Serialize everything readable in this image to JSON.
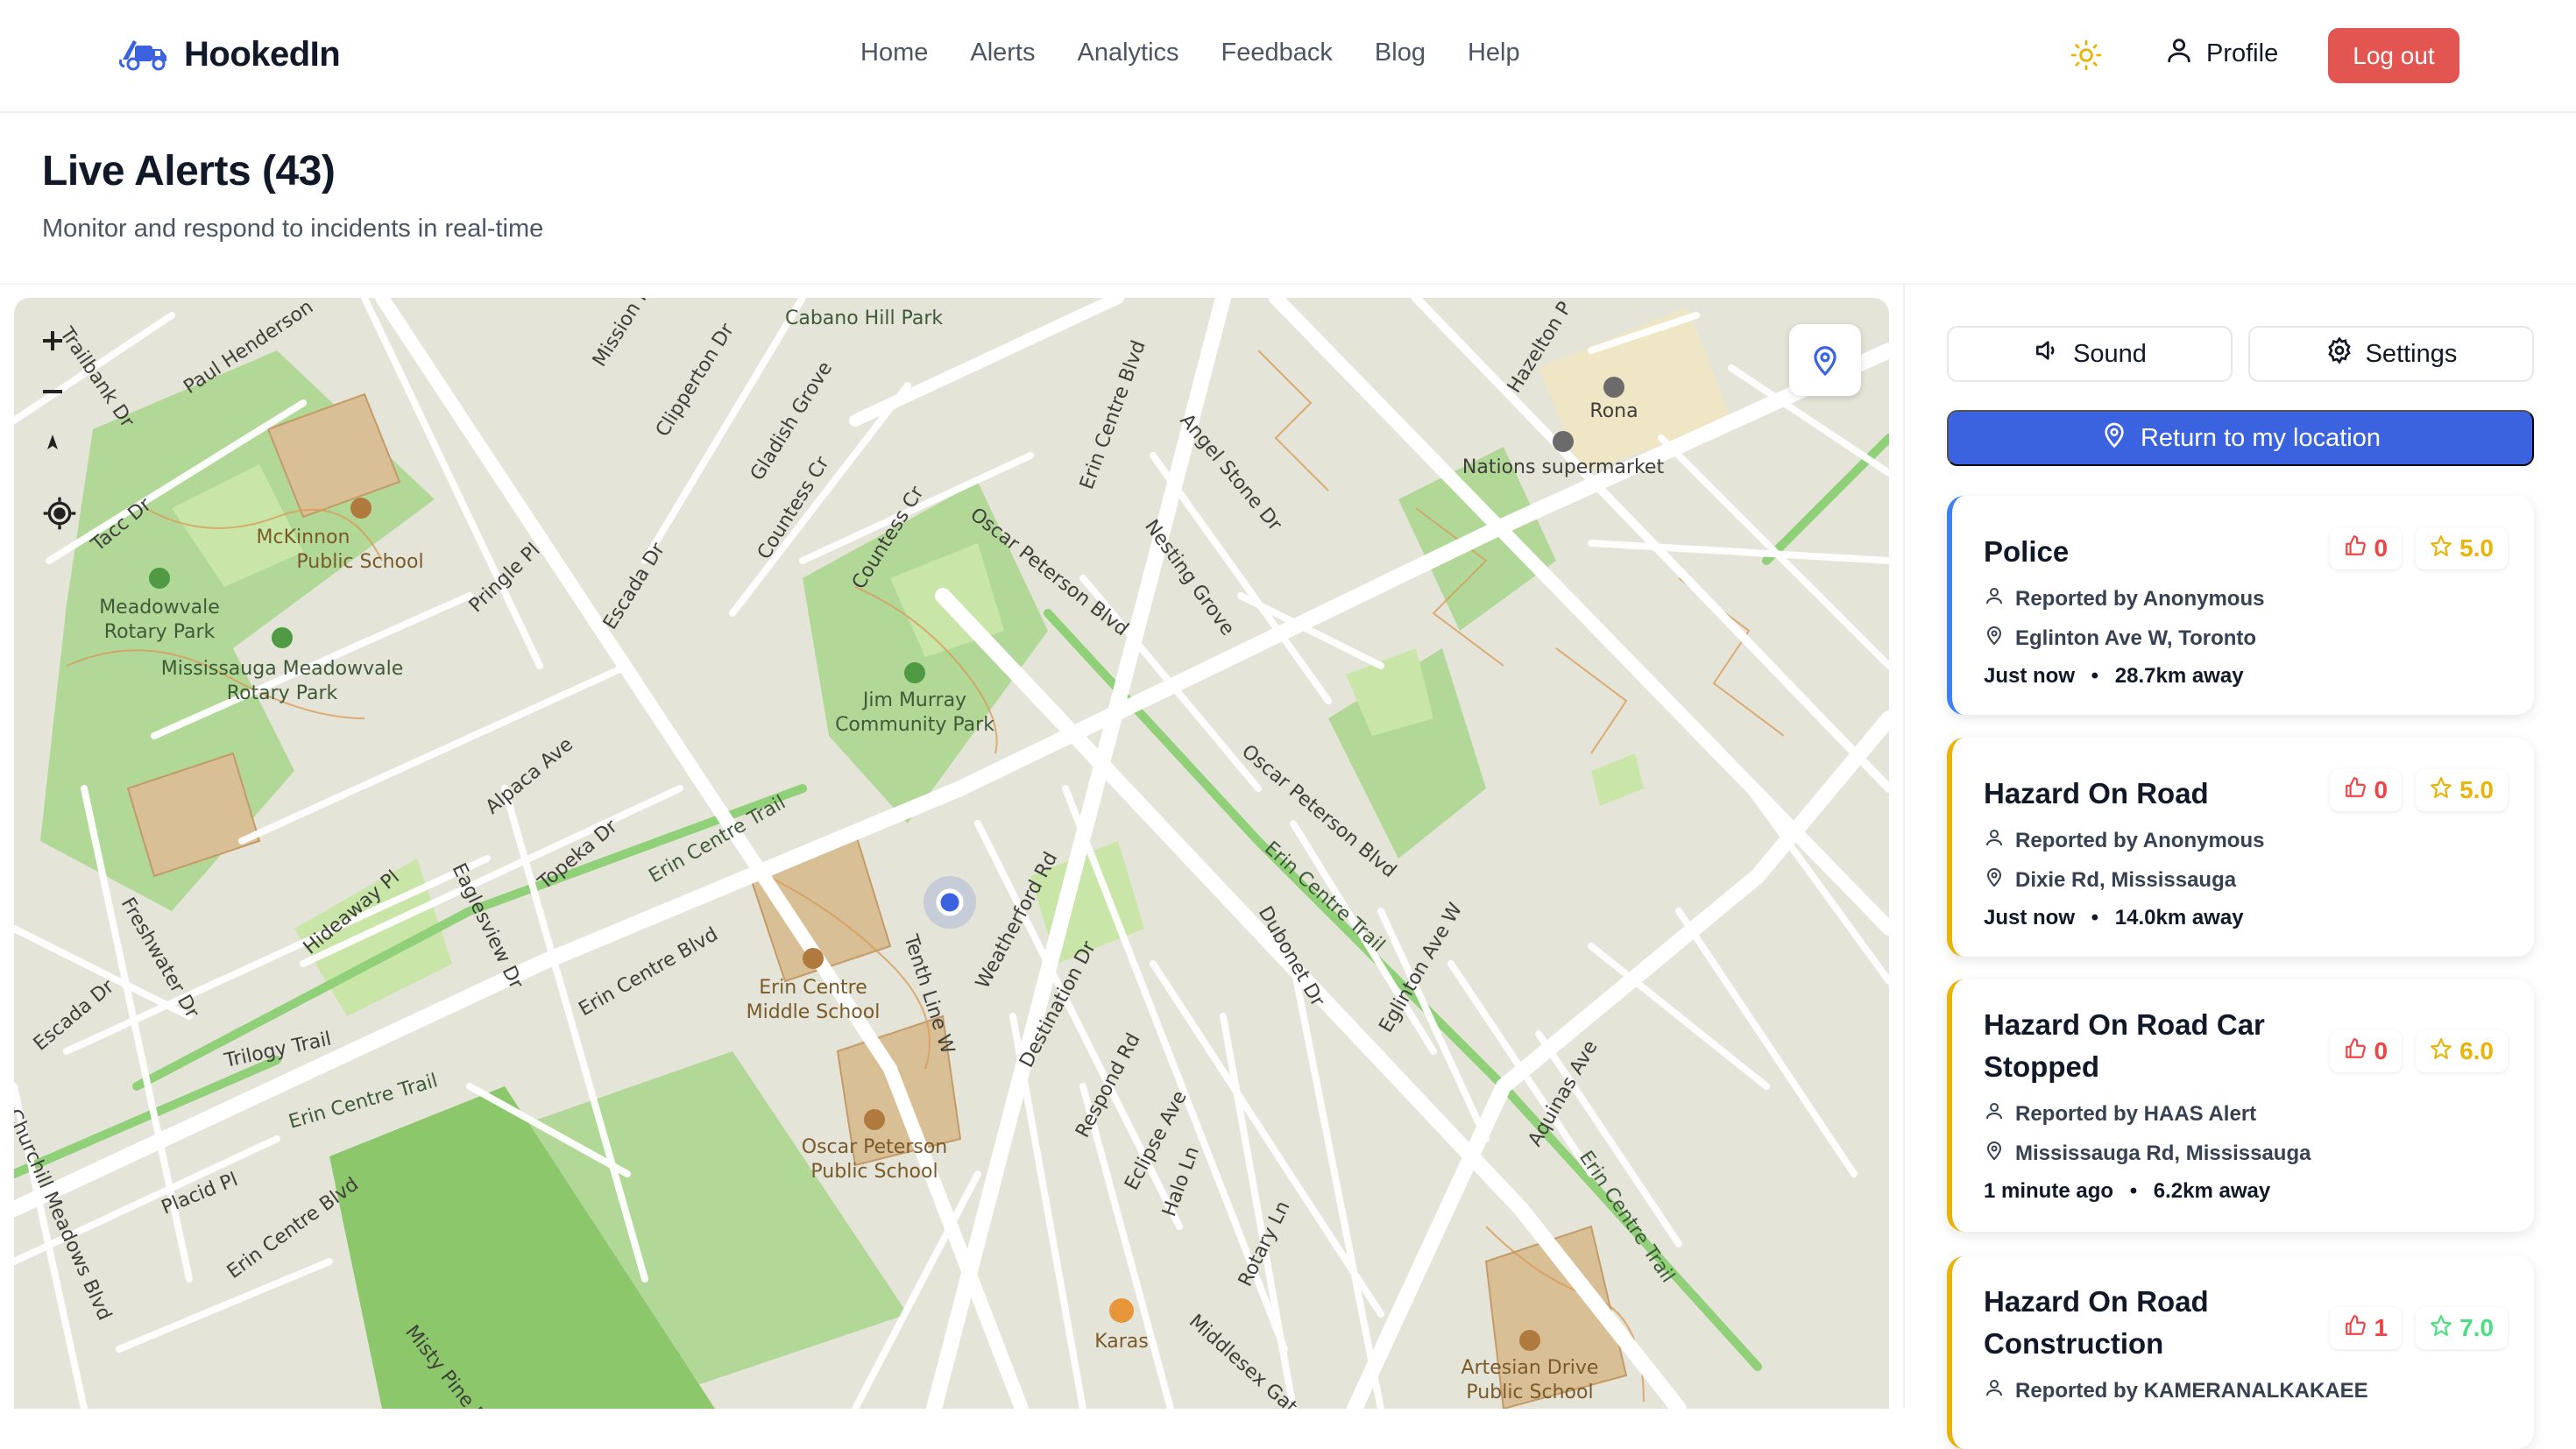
{
  "brand": {
    "name": "HookedIn"
  },
  "nav": {
    "links": [
      "Home",
      "Alerts",
      "Analytics",
      "Feedback",
      "Blog",
      "Help"
    ],
    "profile": "Profile",
    "logout": "Log out"
  },
  "header": {
    "title": "Live Alerts (43)",
    "subtitle": "Monitor and respond to incidents in real-time"
  },
  "map": {
    "labels": {
      "cabano": "Cabano Hill Park",
      "mckinnon1": "McKinnon",
      "mckinnon2": "Public School",
      "meadowvale1": "Meadowvale",
      "meadowvale2": "Rotary Park",
      "mmr1": "Mississauga Meadowvale",
      "mmr2": "Rotary Park",
      "jim1": "Jim Murray",
      "jim2": "Community Park",
      "erin1": "Erin Centre",
      "erin2": "Middle School",
      "oscar1": "Oscar Peterson",
      "oscar2": "Public School",
      "rona": "Rona",
      "nations": "Nations supermarket",
      "karas": "Karas",
      "artesian1": "Artesian Drive",
      "artesian2": "Public School",
      "oscarblvd": "Oscar Peterson Blvd",
      "oscarblvd2": "Oscar Peterson Blvd",
      "erincentre": "Erin Centre Blvd",
      "erincentre2": "Erin Centre Blvd",
      "erincentre3": "Erin Centre Blvd",
      "tenth": "Tenth Line W",
      "eglinton": "Eglinton Ave W",
      "destination": "Destination Dr",
      "weatherford": "Weatherford Rd",
      "dubonet": "Dubonet Dr",
      "respond": "Respond Rd",
      "eclipse": "Eclipse Ave",
      "halo": "Halo Ln",
      "rotary": "Rotary Ln",
      "middlesex": "Middlesex Gate",
      "aquinas": "Aquinas Ave",
      "angel": "Angel Stone Dr",
      "nesting": "Nesting Grove",
      "countess": "Countess Cr",
      "countess2": "Countess Cr",
      "gladish": "Gladish Grove",
      "clipperton": "Clipperton Dr",
      "mission": "Mission R",
      "escada": "Escada Dr",
      "escada2": "Escada Dr",
      "pringle": "Pringle Pl",
      "alpaca": "Alpaca Ave",
      "topeka": "Topeka Dr",
      "hideaway": "Hideaway Pl",
      "eaglesview": "Eaglesview Dr",
      "freshwater": "Freshwater Dr",
      "trilogy": "Trilogy Trail",
      "placid": "Placid Pl",
      "churchill": "Churchill Meadows Blvd",
      "misty": "Misty Pine D",
      "tacc": "Tacc Dr",
      "paulhenderson": "Paul Henderson",
      "trailbank": "Trailbank Dr",
      "hazelton": "Hazelton P",
      "erintrail": "Erin Centre Trail",
      "erintrail2": "Erin Centre Trail",
      "erintrail3": "Erin Centre Trail",
      "erintrail4": "Erin Centre Trail"
    }
  },
  "panel": {
    "sound": "Sound",
    "settings": "Settings",
    "return": "Return to my location",
    "alerts": [
      {
        "title": "Police",
        "likes": "0",
        "score": "5.0",
        "reporter": "Reported by Anonymous",
        "location": "Eglinton Ave W, Toronto",
        "time": "Just now",
        "distance": "28.7km away",
        "accent": "#3b82f6"
      },
      {
        "title": "Hazard On Road",
        "likes": "0",
        "score": "5.0",
        "reporter": "Reported by Anonymous",
        "location": "Dixie Rd, Mississauga",
        "time": "Just now",
        "distance": "14.0km away",
        "accent": "#eab308"
      },
      {
        "title": "Hazard On Road Car Stopped",
        "likes": "0",
        "score": "6.0",
        "reporter": "Reported by HAAS Alert",
        "location": "Mississauga Rd, Mississauga",
        "time": "1 minute ago",
        "distance": "6.2km away",
        "accent": "#eab308"
      },
      {
        "title": "Hazard On Road Construction",
        "likes": "1",
        "score": "7.0",
        "reporter": "Reported by KAMERANALKAKAEE",
        "accent": "#eab308"
      }
    ]
  },
  "colors": {
    "primary": "#3b63e0",
    "logout": "#e25550",
    "danger": "#ef4444",
    "gold": "#eab308",
    "green": "#4ade80"
  }
}
